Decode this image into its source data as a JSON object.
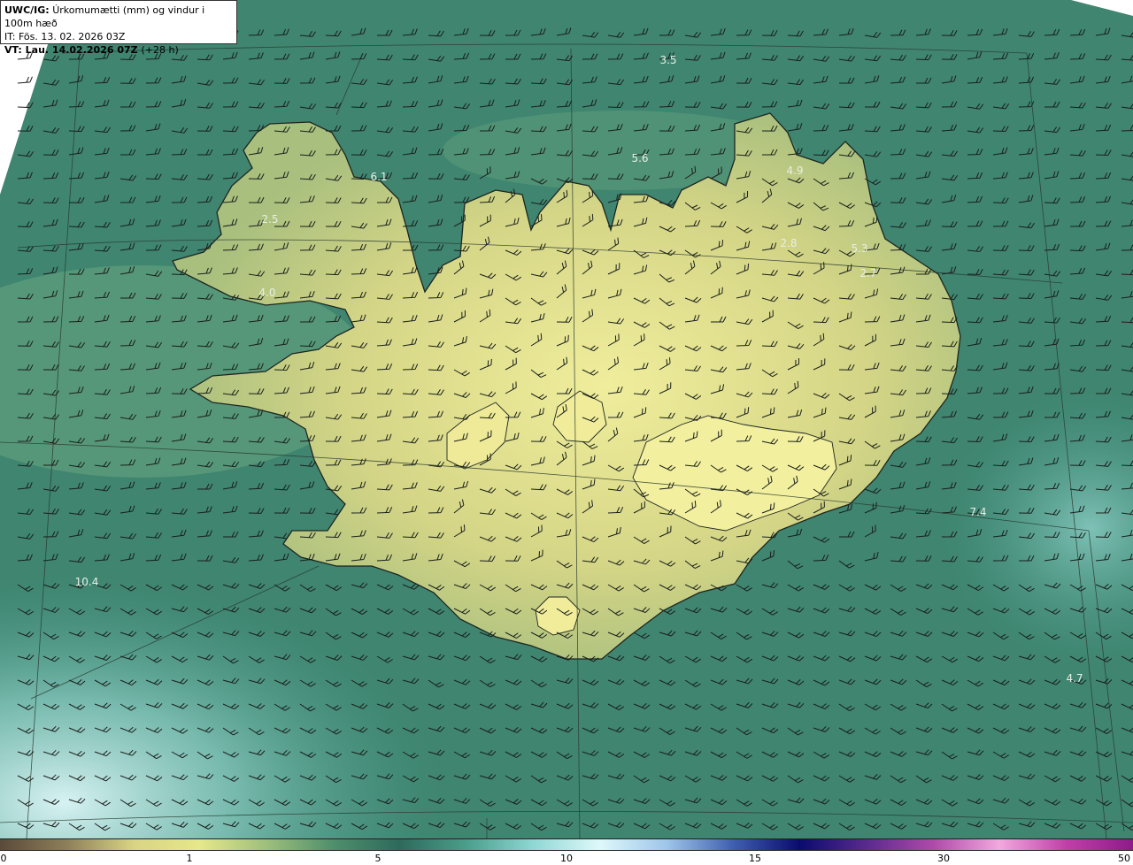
{
  "header": {
    "title_prefix": "UWC/IG:",
    "title_text": "Úrkomumætti (mm) og vindur i 100m hæð",
    "initial_time": "IT: Fös. 13. 02. 2026 03Z",
    "valid_time_prefix": "VT: Lau. 14.02.2026 07Z",
    "valid_time_suffix": "(+28 h)"
  },
  "map_labels": [
    {
      "text": "3.5",
      "id": "north-sea-3-5"
    },
    {
      "text": "5.6",
      "id": "north-coast-5-6"
    },
    {
      "text": "4.9",
      "id": "northeast-4-9"
    },
    {
      "text": "6.1",
      "id": "westfjords-6-1"
    },
    {
      "text": "2.5",
      "id": "westfjords-2-5"
    },
    {
      "text": "2.8",
      "id": "northeast-2-8"
    },
    {
      "text": "5.3",
      "id": "east-5-3"
    },
    {
      "text": "2.7",
      "id": "east-2-7"
    },
    {
      "text": "4.0",
      "id": "west-4-0"
    },
    {
      "text": "7.4",
      "id": "southeast-sea-7-4"
    },
    {
      "text": "10.4",
      "id": "southwest-sea-10-4"
    },
    {
      "text": "4.7",
      "id": "south-sea-4-7"
    }
  ],
  "colorbar": {
    "ticks": [
      "0",
      "1",
      "5",
      "10",
      "15",
      "30",
      "50"
    ],
    "colors": [
      "#5a4a3a",
      "#8e7f5a",
      "#d8d484",
      "#e6e88a",
      "#9fbf7c",
      "#4f8f6c",
      "#2e6a5c",
      "#4b9e8c",
      "#8fd8d4",
      "#dff8fa",
      "#9fc6ea",
      "#3f5fb0",
      "#0b0b6e",
      "#5a2a8e",
      "#b04aaa",
      "#f2a8de",
      "#c040a8",
      "#8e1a8a"
    ]
  },
  "map": {
    "ocean_color": "#3f8570",
    "land_color": "#d9d990",
    "coast_color": "#1e2620",
    "barb_color": "#1a1f1c"
  }
}
